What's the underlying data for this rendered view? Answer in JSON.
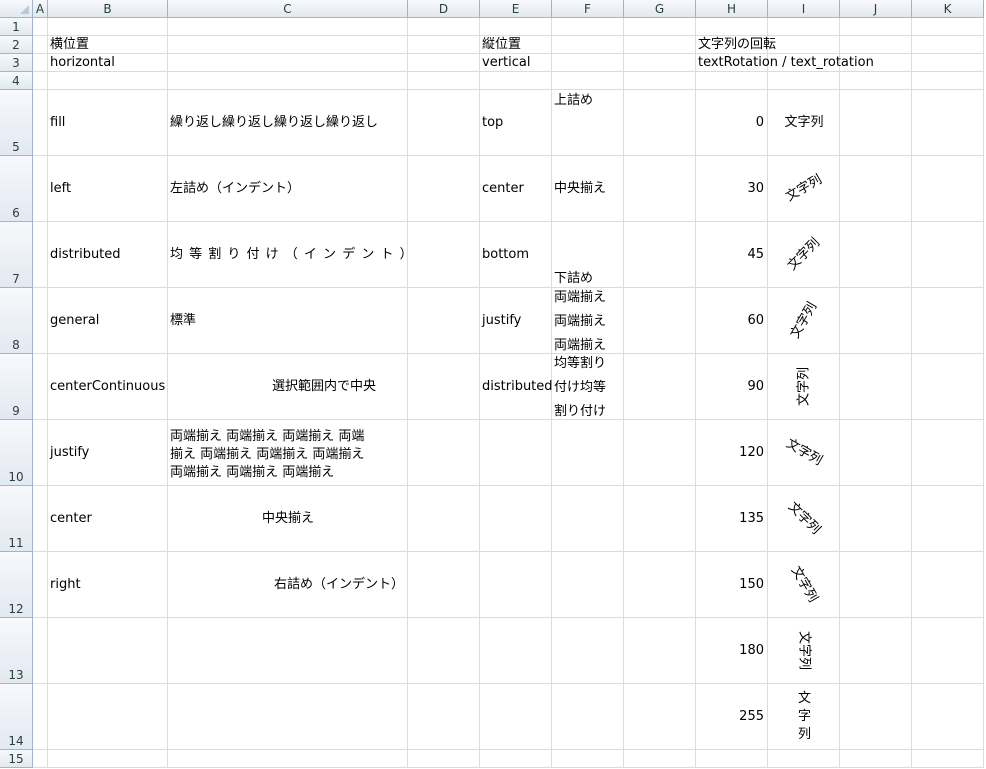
{
  "columns": [
    "A",
    "B",
    "C",
    "D",
    "E",
    "F",
    "G",
    "H",
    "I",
    "J",
    "K"
  ],
  "rows": [
    "1",
    "2",
    "3",
    "4",
    "5",
    "6",
    "7",
    "8",
    "9",
    "10",
    "11",
    "12",
    "13",
    "14",
    "15"
  ],
  "headers": {
    "horizontal_jp": "横位置",
    "horizontal_en": "horizontal",
    "vertical_jp": "縦位置",
    "vertical_en": "vertical",
    "rotation_jp": "文字列の回転",
    "rotation_en": "textRotation / text_rotation"
  },
  "horizontal": [
    {
      "name": "fill",
      "sample": "繰り返し繰り返し繰り返し繰り返し"
    },
    {
      "name": "left",
      "sample": "左詰め（インデント）"
    },
    {
      "name": "distributed",
      "sample": "均 等 割 り 付 け （ イ ン デ ン ト ）"
    },
    {
      "name": "general",
      "sample": "標準"
    },
    {
      "name": "centerContinuous",
      "sample": "選択範囲内で中央"
    },
    {
      "name": "justify",
      "sample_lines": [
        "両端揃え 両端揃え 両端揃え 両端",
        "揃え 両端揃え 両端揃え 両端揃え",
        "両端揃え 両端揃え 両端揃え"
      ]
    },
    {
      "name": "center",
      "sample": "中央揃え"
    },
    {
      "name": "right",
      "sample": "右詰め（インデント）"
    }
  ],
  "vertical": [
    {
      "name": "top",
      "sample": "上詰め"
    },
    {
      "name": "center",
      "sample": "中央揃え"
    },
    {
      "name": "bottom",
      "sample": "下詰め"
    },
    {
      "name": "justify",
      "sample_lines": [
        "両端揃え",
        "両端揃え",
        "両端揃え"
      ]
    },
    {
      "name": "distributed",
      "sample_lines": [
        "均等割り",
        "付け均等",
        "割り付け"
      ]
    }
  ],
  "rotation": [
    {
      "value": "0",
      "sample": "文字列"
    },
    {
      "value": "30",
      "sample": "文字列"
    },
    {
      "value": "45",
      "sample": "文字列"
    },
    {
      "value": "60",
      "sample": "文字列"
    },
    {
      "value": "90",
      "sample": "文字列"
    },
    {
      "value": "120",
      "sample": "文字列"
    },
    {
      "value": "135",
      "sample": "文字列"
    },
    {
      "value": "150",
      "sample": "文字列"
    },
    {
      "value": "180",
      "sample": "文字列"
    },
    {
      "value": "255",
      "sample": "文字列"
    }
  ]
}
